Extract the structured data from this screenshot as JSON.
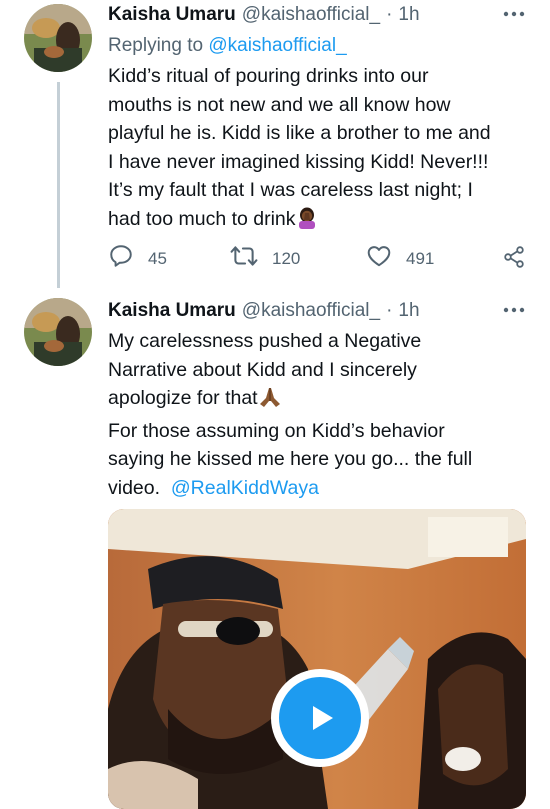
{
  "tweet1": {
    "name": "Kaisha Umaru",
    "handle": "@kaishaofficial_",
    "dot": "·",
    "time": "1h",
    "reply_prefix": "Replying to",
    "reply_handle": "@kaishaofficial_",
    "lines": [
      "Kidd’s ritual of pouring drinks into our",
      "mouths is not new and we all know how",
      "playful he is. Kidd is like a brother to me and",
      "I have never imagined kissing Kidd! Never!!!",
      "It’s my fault that I was careless last night; I",
      "had too much to drink"
    ],
    "emoji_icon": "woman-facepalming-emoji",
    "replies": "45",
    "retweets": "120",
    "likes": "491"
  },
  "tweet2": {
    "name": "Kaisha Umaru",
    "handle": "@kaishaofficial_",
    "dot": "·",
    "time": "1h",
    "lines": [
      "My carelessness pushed a Negative",
      "Narrative about Kidd and I sincerely",
      "apologize for that",
      "For those assuming on Kidd’s behavior",
      "saying he kissed me here you go... the full",
      "video."
    ],
    "emoji_icon": "folded-hands-emoji",
    "mention": "@RealKiddWaya"
  },
  "colors": {
    "accent": "#1d9bf0",
    "secondary_text": "#536471",
    "thread_line": "#c4cfd6"
  }
}
